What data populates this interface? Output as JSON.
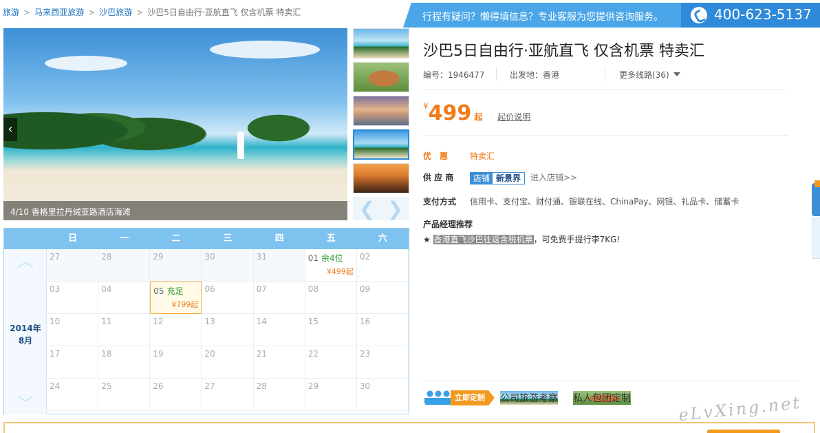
{
  "breadcrumb": {
    "items": [
      "旅游",
      "马来西亚旅游",
      "沙巴旅游"
    ],
    "separator": ">",
    "current": "沙巴5日自由行·亚航直飞 仅含机票 特卖汇"
  },
  "service": {
    "message": "行程有疑问？懒得填信息？专业客服为您提供咨询服务。",
    "phone": "400-623-5137"
  },
  "gallery": {
    "caption": "4/10 香格里拉丹绒亚路酒店海滩",
    "prev_icon": "‹",
    "thumb_prev_icon": "❮",
    "thumb_next_icon": "❯"
  },
  "calendar": {
    "weekdays": [
      "日",
      "一",
      "二",
      "三",
      "四",
      "五",
      "六"
    ],
    "year_label": "2014年",
    "month_label": "8月",
    "up_icon": "︿",
    "down_icon": "﹀",
    "days": [
      {
        "d": "27"
      },
      {
        "d": "28"
      },
      {
        "d": "29"
      },
      {
        "d": "30"
      },
      {
        "d": "31"
      },
      {
        "d": "01",
        "status": "余4位",
        "price": "¥499起"
      },
      {
        "d": "02"
      },
      {
        "d": "03"
      },
      {
        "d": "04"
      },
      {
        "d": "05",
        "status": "充足",
        "price": "¥799起"
      },
      {
        "d": "06"
      },
      {
        "d": "07"
      },
      {
        "d": "08"
      },
      {
        "d": "09"
      },
      {
        "d": "10"
      },
      {
        "d": "11"
      },
      {
        "d": "12"
      },
      {
        "d": "13"
      },
      {
        "d": "14"
      },
      {
        "d": "15"
      },
      {
        "d": "16"
      },
      {
        "d": "17"
      },
      {
        "d": "18"
      },
      {
        "d": "19"
      },
      {
        "d": "20"
      },
      {
        "d": "21"
      },
      {
        "d": "22"
      },
      {
        "d": "23"
      },
      {
        "d": "24"
      },
      {
        "d": "25"
      },
      {
        "d": "26"
      },
      {
        "d": "27"
      },
      {
        "d": "28"
      },
      {
        "d": "29"
      },
      {
        "d": "30"
      }
    ]
  },
  "product": {
    "title": "沙巴5日自由行·亚航直飞 仅含机票 特卖汇",
    "code": "编号：1946477",
    "departure": "出发地：香港",
    "more_routes": "更多线路(36)",
    "price_symbol": "¥",
    "price": "499",
    "price_suffix": "起",
    "price_explain": "起价说明",
    "promo_label": "优　惠",
    "promo_value": "特卖汇",
    "supplier_label": "供 应 商",
    "supplier_badge_a": "店铺",
    "supplier_badge_b": "新景界",
    "supplier_link": "进入店铺>>",
    "payment_label": "支付方式",
    "payment_value": "信用卡、支付宝、财付通、银联在线、ChinaPay、网银、礼品卡、储蓄卡",
    "recommend_label": "产品经理推荐",
    "recommend_star": "★",
    "recommend_highlight": "香港直飞沙巴往返含税机票",
    "recommend_rest": "，可免费手提行李7KG!"
  },
  "custom": {
    "button": "立即定制",
    "text1": "公司旅游考察",
    "text2": "私人包团定制"
  },
  "watermark": "eLvXing.net",
  "colors": {
    "brand_blue": "#2f8ad9",
    "price_orange": "#f27b1a",
    "available_green": "#2c9a2c"
  }
}
